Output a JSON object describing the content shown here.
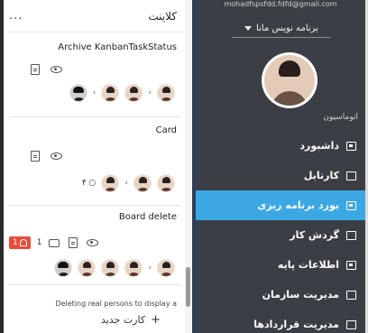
{
  "column": {
    "menu": "...",
    "title": "کلاینت",
    "add_card": "کارت جدید",
    "add_plus": "+"
  },
  "cards": [
    {
      "title": "Archive KanbanTaskStatus"
    },
    {
      "title": "Card",
      "count": "۴ ○"
    },
    {
      "title": "Board delete",
      "comments": "1",
      "alerts": "1"
    }
  ],
  "note": "Deleting real persons to display a",
  "sidebar": {
    "email": "mohadfspsfdd.fdfd@gmail.com",
    "role": "برنامه نویس مانا",
    "section": "اتوماسیون",
    "items": [
      {
        "label": "داشبورد",
        "icon": "dashboard-icon"
      },
      {
        "label": "کارتابل",
        "icon": "inbox-icon"
      },
      {
        "label": "بورد برنامه ریزی",
        "icon": "board-icon",
        "active": true
      },
      {
        "label": "گردش کار",
        "icon": "workflow-icon"
      },
      {
        "label": "اطلاعات پایه",
        "icon": "database-icon"
      },
      {
        "label": "مدیریت سازمان",
        "icon": "organization-icon"
      },
      {
        "label": "مدیریت قراردادها",
        "icon": "contracts-icon"
      }
    ]
  },
  "colors": {
    "sidebar": "#3b3f45",
    "active": "#3ba7e3",
    "badge": "#e74c3c"
  }
}
